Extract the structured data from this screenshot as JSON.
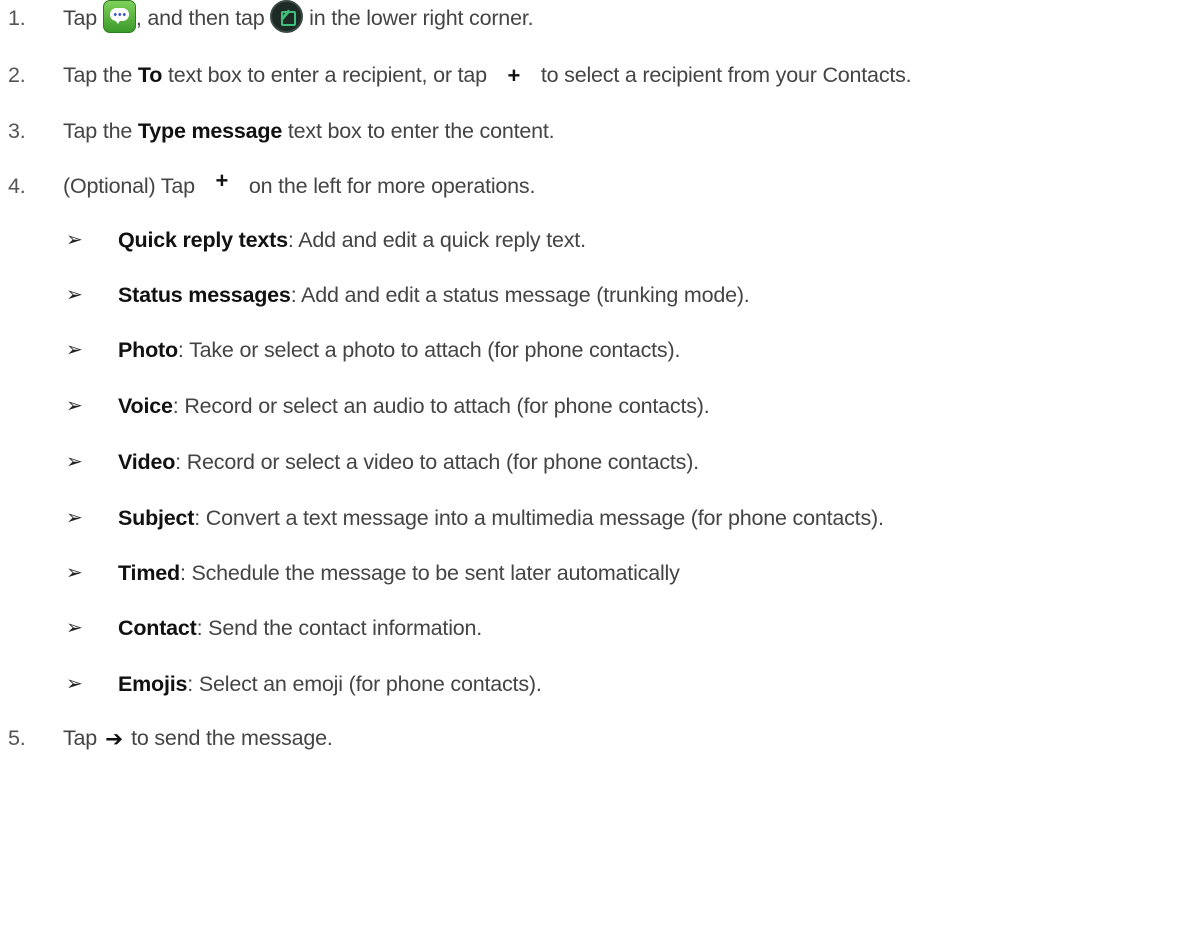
{
  "steps": [
    {
      "num": "1.",
      "tap": "Tap",
      "part2": ", and then tap",
      "part3": "in the lower right corner."
    },
    {
      "num": "2.",
      "part1": "Tap the",
      "bold1": "To",
      "part2": "text box to enter a recipient, or tap",
      "part3": "to select a recipient from your Contacts."
    },
    {
      "num": "3.",
      "part1": "Tap the",
      "bold1": "Type message",
      "part2": "text box to enter the content."
    },
    {
      "num": "4.",
      "part1": "(Optional) Tap",
      "part2": "on the left for more operations."
    },
    {
      "num": "5.",
      "part1": "Tap",
      "part2": "to send the message."
    }
  ],
  "icons": {
    "messages_app": "messages-app-icon",
    "compose": "compose-icon",
    "add_recipient": "plus-icon",
    "more_operations": "plus-icon",
    "send": "send-arrow-icon",
    "plus_glyph": "+",
    "send_glyph": "➔",
    "bullet_glyph": "➢"
  },
  "options": [
    {
      "label": "Quick reply texts",
      "desc": ": Add and edit a quick reply text."
    },
    {
      "label": "Status messages",
      "desc": ": Add and edit a status message (trunking mode)."
    },
    {
      "label": "Photo",
      "desc": ": Take or select a photo to attach (for phone contacts)."
    },
    {
      "label": "Voice",
      "desc": ": Record or select an audio to attach (for phone contacts)."
    },
    {
      "label": "Video",
      "desc": ": Record or select a video to attach (for phone contacts)."
    },
    {
      "label": "Subject",
      "desc": ": Convert a text message into a multimedia message (for phone contacts)."
    },
    {
      "label": "Timed",
      "desc": ": Schedule the message to be sent later automatically"
    },
    {
      "label": "Contact",
      "desc": ": Send the contact information."
    },
    {
      "label": "Emojis",
      "desc": ": Select an emoji (for phone contacts)."
    }
  ]
}
